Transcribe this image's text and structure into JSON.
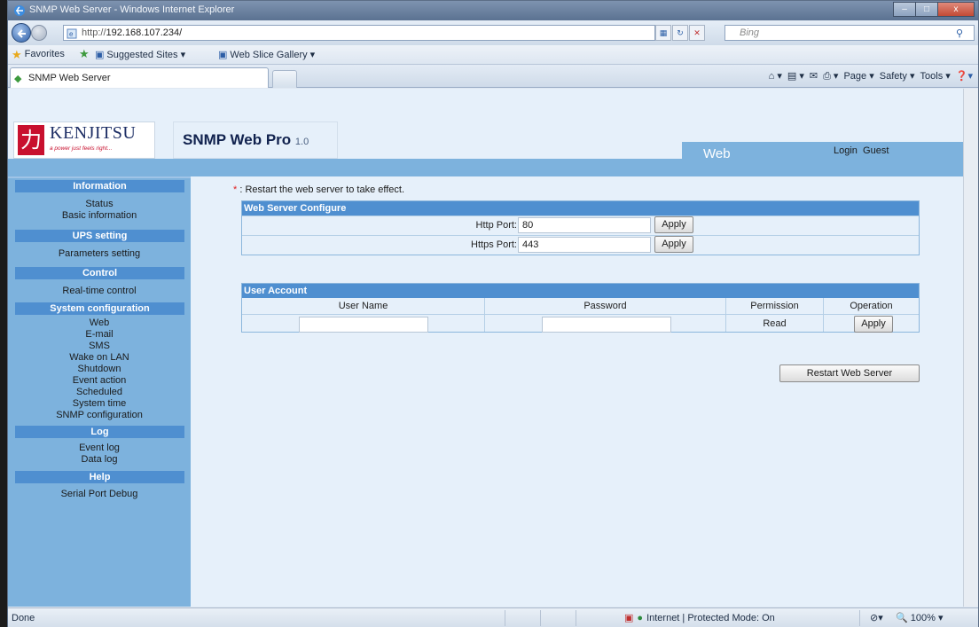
{
  "window": {
    "title": "SNMP Web Server - Windows Internet Explorer",
    "controls": {
      "minimize": "–",
      "maximize": "□",
      "close": "x"
    }
  },
  "addressbar": {
    "url_prefix": "http://",
    "url_host": "192.168.107.234/",
    "search_placeholder": "Bing"
  },
  "favorites": {
    "favorites_label": "Favorites",
    "suggested_sites": "Suggested Sites ▾",
    "web_slice": "Web Slice Gallery ▾"
  },
  "tabs": {
    "active_label": "SNMP Web Server",
    "commands": {
      "page": "Page ▾",
      "safety": "Safety ▾",
      "tools": "Tools ▾"
    }
  },
  "header": {
    "brand": "KENJITSU",
    "kanji": "力",
    "tagline": "a power just feels right...",
    "product": "SNMP Web Pro",
    "version": "1.0",
    "section": "Web",
    "login_prefix": "Login",
    "login_user": "Guest"
  },
  "sidebar": {
    "sections": [
      {
        "title": "Information",
        "items": [
          "Status",
          "Basic information"
        ]
      },
      {
        "title": "UPS setting",
        "items": [
          "Parameters setting"
        ]
      },
      {
        "title": "Control",
        "items": [
          "Real-time control"
        ]
      },
      {
        "title": "System configuration",
        "items": [
          "Web",
          "E-mail",
          "SMS",
          "Wake on LAN",
          "Shutdown",
          "Event action",
          "Scheduled",
          "System time",
          "SNMP configuration"
        ]
      },
      {
        "title": "Log",
        "items": [
          "Event log",
          "Data log"
        ]
      },
      {
        "title": "Help",
        "items": [
          "Serial Port Debug"
        ]
      }
    ]
  },
  "content": {
    "note_marker": "*",
    "note_text": ": Restart the web server to take effect.",
    "web_server": {
      "title": "Web Server Configure",
      "http_label": "Http Port:",
      "http_value": "80",
      "https_label": "Https Port:",
      "https_value": "443",
      "apply_label": "Apply"
    },
    "user_account": {
      "title": "User Account",
      "columns": [
        "User Name",
        "Password",
        "Permission",
        "Operation"
      ],
      "row": {
        "username": "",
        "password": "",
        "permission": "Read",
        "operation": "Apply"
      }
    },
    "restart_button": "Restart Web Server"
  },
  "statusbar": {
    "status": "Done",
    "zone": "Internet | Protected Mode: On",
    "zoom": "100%"
  }
}
